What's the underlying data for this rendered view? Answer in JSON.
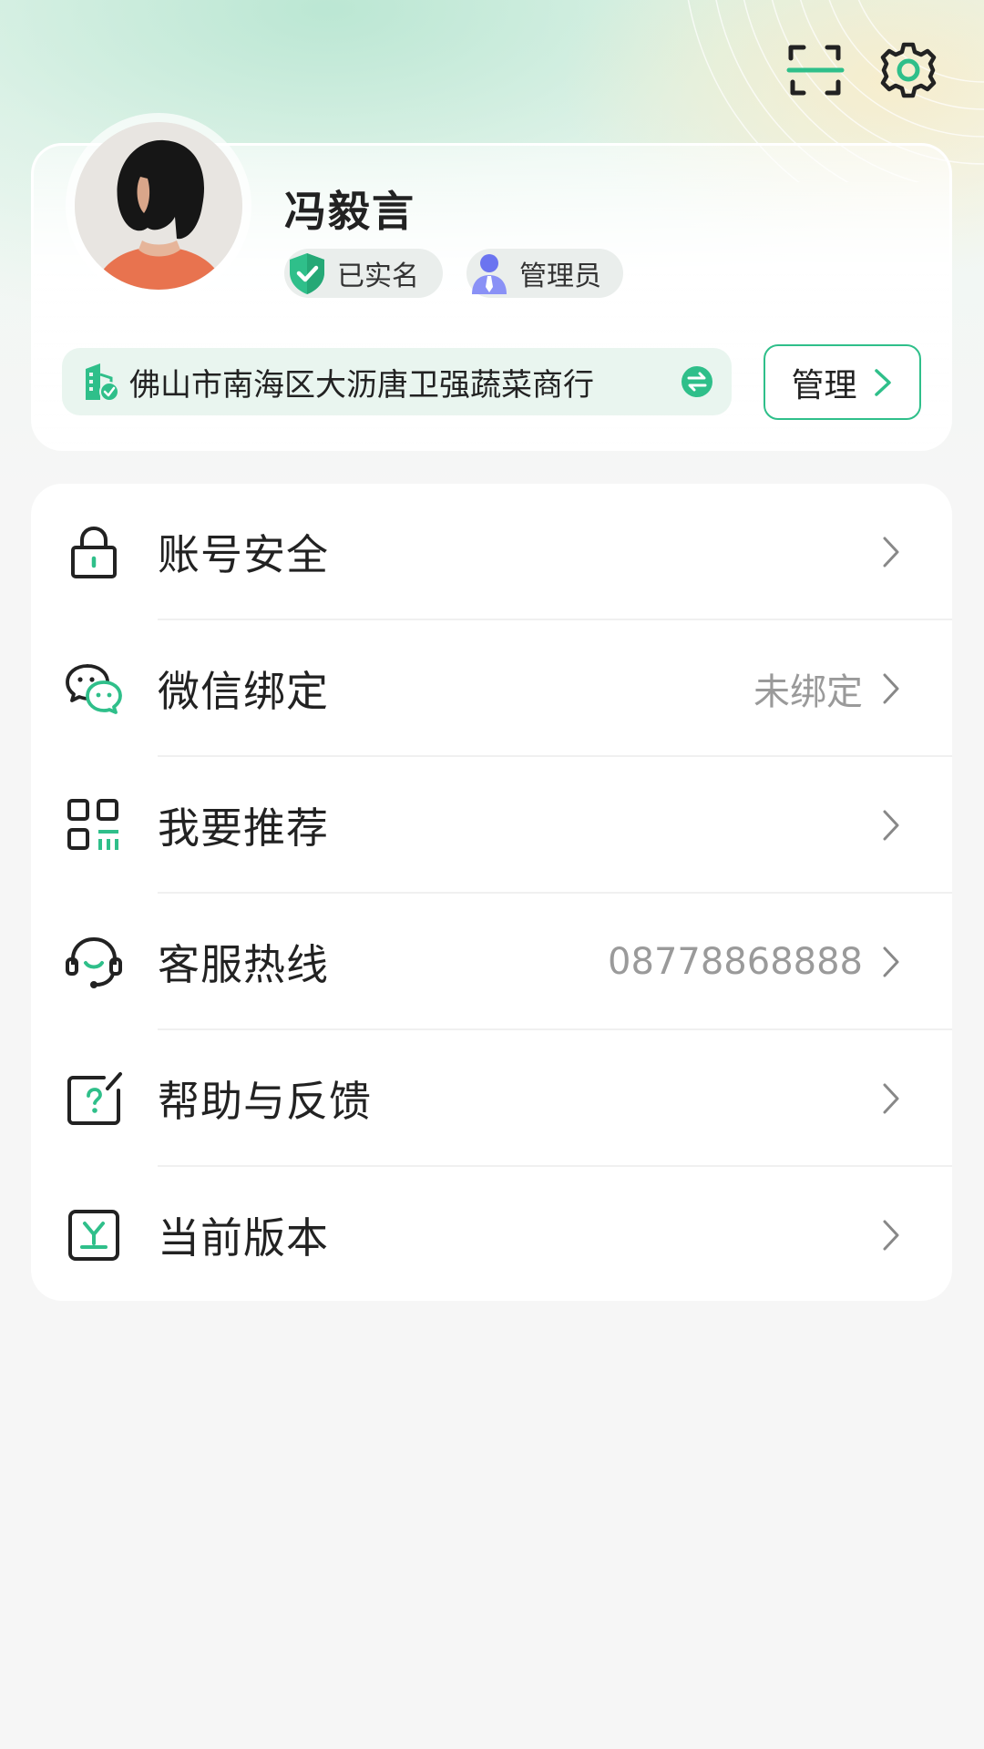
{
  "header": {
    "scan_icon": "scan-icon",
    "settings_icon": "gear-icon"
  },
  "profile": {
    "name": "冯毅言",
    "verified_tag": "已实名",
    "role_tag": "管理员",
    "company": "佛山市南海区大沥唐卫强蔬菜商行",
    "manage_label": "管理"
  },
  "menu": [
    {
      "label": "账号安全",
      "value": "",
      "icon": "lock-icon"
    },
    {
      "label": "微信绑定",
      "value": "未绑定",
      "icon": "wechat-icon"
    },
    {
      "label": "我要推荐",
      "value": "",
      "icon": "qr-code-icon"
    },
    {
      "label": "客服热线",
      "value": "08778868888",
      "icon": "headset-icon"
    },
    {
      "label": "帮助与反馈",
      "value": "",
      "icon": "help-feedback-icon"
    },
    {
      "label": "当前版本",
      "value": "",
      "icon": "version-download-icon"
    }
  ],
  "colors": {
    "accent": "#2fbf8a",
    "background": "#f6f6f6",
    "text_secondary": "#9a9a9a"
  }
}
